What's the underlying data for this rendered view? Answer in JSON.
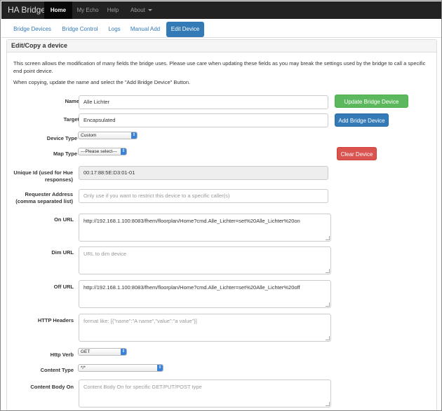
{
  "navbar": {
    "brand": "HA Bridge",
    "items": [
      {
        "label": "Home"
      },
      {
        "label": "My Echo"
      },
      {
        "label": "Help"
      },
      {
        "label": "About"
      }
    ]
  },
  "tabs": [
    {
      "label": "Bridge Devices"
    },
    {
      "label": "Bridge Control"
    },
    {
      "label": "Logs"
    },
    {
      "label": "Manual Add"
    },
    {
      "label": "Edit Device"
    }
  ],
  "panel": {
    "title": "Edit/Copy a device",
    "desc1": "This screen allows the modification of many fields the bridge uses. Please use care when updating these fields as you may break the settings used by the bridge to call a specific end point device.",
    "desc2": "When copying, update the name and select the \"Add Bridge Device\" Button."
  },
  "form": {
    "name_label": "Name",
    "name_value": "Alle Lichter",
    "target_label": "Target",
    "target_value": "Encapsulated",
    "device_type_label": "Device Type",
    "device_type_value": "Custom",
    "map_type_label": "Map Type",
    "map_type_value": "---Please select---",
    "unique_id_label": "Unique Id (used for Hue responses)",
    "unique_id_value": "00:17:88:5E:D3:01-01",
    "requester_label": "Requester Address (comma separated list)",
    "requester_placeholder": "Only use if you want to restrict this device to a specific caller(s)",
    "on_url_label": "On URL",
    "on_url_value": "http://192.168.1.100:8083/fhem/floorplan/Home?cmd.Alle_Lichter=set%20Alle_Lichter%20on",
    "dim_url_label": "Dim URL",
    "dim_url_placeholder": "URL to dim device",
    "off_url_label": "Off URL",
    "off_url_value": "http://192.168.1.100:8083/fhem/floorplan/Home?cmd.Alle_Lichter=set%20Alle_Lichter%20off",
    "headers_label": "HTTP Headers",
    "headers_placeholder": "format like: [{\"name\":\"A name\",\"value\":\"a value\"}]",
    "verb_label": "Http Verb",
    "verb_value": "GET",
    "content_type_label": "Content Type",
    "content_type_value": "*/*",
    "body_on_label": "Content Body On",
    "body_on_placeholder": "Content Body On for specific GET/PUT/POST type"
  },
  "buttons": {
    "update": "Update Bridge Device",
    "add": "Add Bridge Device",
    "clear": "Clear Device"
  },
  "colors": {
    "navbar": "#222222",
    "accent": "#337ab7",
    "success": "#5cb85c",
    "danger": "#d9534f"
  }
}
